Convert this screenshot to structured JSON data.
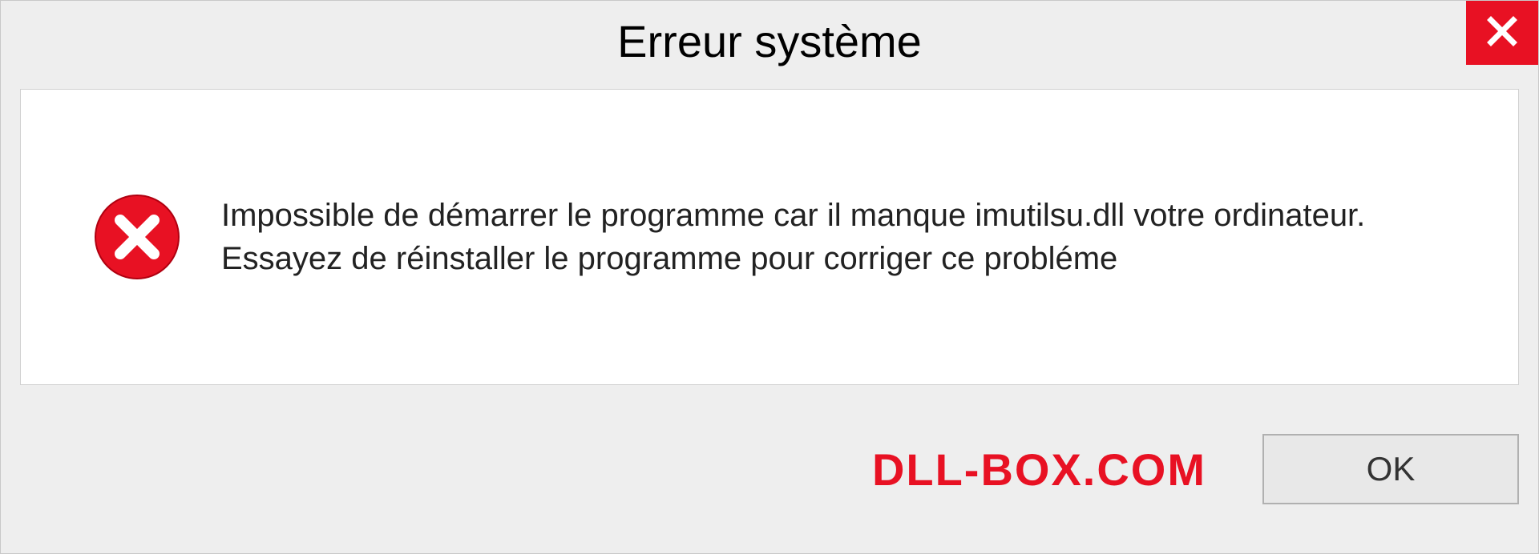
{
  "titlebar": {
    "title": "Erreur système"
  },
  "content": {
    "message": "Impossible de démarrer le programme car il manque imutilsu.dll votre ordinateur. Essayez de réinstaller le programme pour corriger ce probléme"
  },
  "footer": {
    "watermark": "DLL-BOX.COM",
    "ok_label": "OK"
  }
}
